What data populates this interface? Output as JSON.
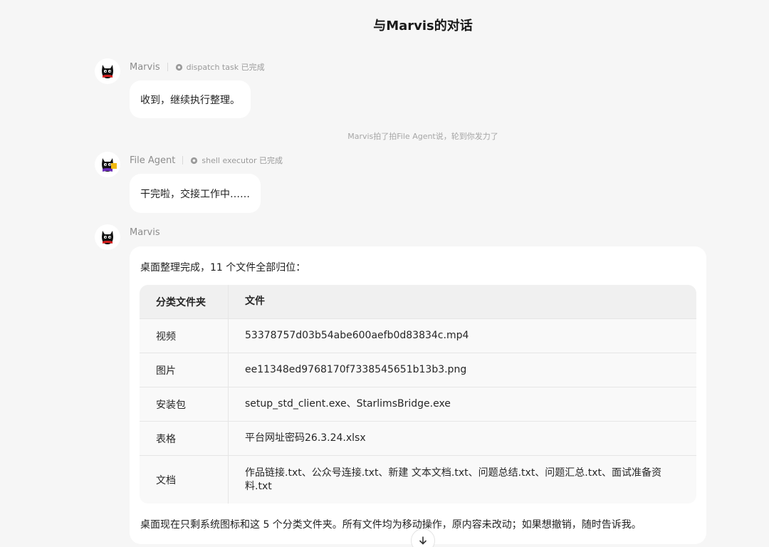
{
  "header": {
    "title": "与Marvis的对话"
  },
  "messages": [
    {
      "sender": "Marvis",
      "tool": "dispatch task 已完成",
      "text": "收到，继续执行整理。"
    },
    {
      "sender": "File Agent",
      "tool": "shell executor 已完成",
      "text": "干完啦，交接工作中……"
    },
    {
      "sender": "Marvis"
    }
  ],
  "system_note": "Marvis拍了拍File Agent说，轮到你发力了",
  "result_card": {
    "intro": "桌面整理完成，11 个文件全部归位：",
    "table": {
      "headers": [
        "分类文件夹",
        "文件"
      ],
      "rows": [
        {
          "category": "视频",
          "files": "53378757d03b54abe600aefb0d83834c.mp4"
        },
        {
          "category": "图片",
          "files": "ee11348ed9768170f7338545651b13b3.png"
        },
        {
          "category": "安装包",
          "files": "setup_std_client.exe、StarlimsBridge.exe"
        },
        {
          "category": "表格",
          "files": "平台网址密码26.3.24.xlsx"
        },
        {
          "category": "文档",
          "files": "作品链接.txt、公众号连接.txt、新建 文本文档.txt、问题总结.txt、问题汇总.txt、面试准备资料.txt"
        }
      ]
    },
    "outro": "桌面现在只剩系统图标和这 5 个分类文件夹。所有文件均为移动操作，原内容未改动；如果想撤销，随时告诉我。"
  },
  "icons": {
    "marvis_avatar": "black-cat-mascot-icon",
    "file_agent_avatar": "black-cat-with-folder-icon",
    "tool_status": "gear-icon",
    "scroll_down": "arrow-down-icon"
  },
  "colors": {
    "background": "#f6f6f6",
    "bubble": "#ffffff",
    "mascot_red": "#d81e1e",
    "mascot_purple": "#6a2cb8",
    "mascot_yellow": "#f2b90f"
  }
}
